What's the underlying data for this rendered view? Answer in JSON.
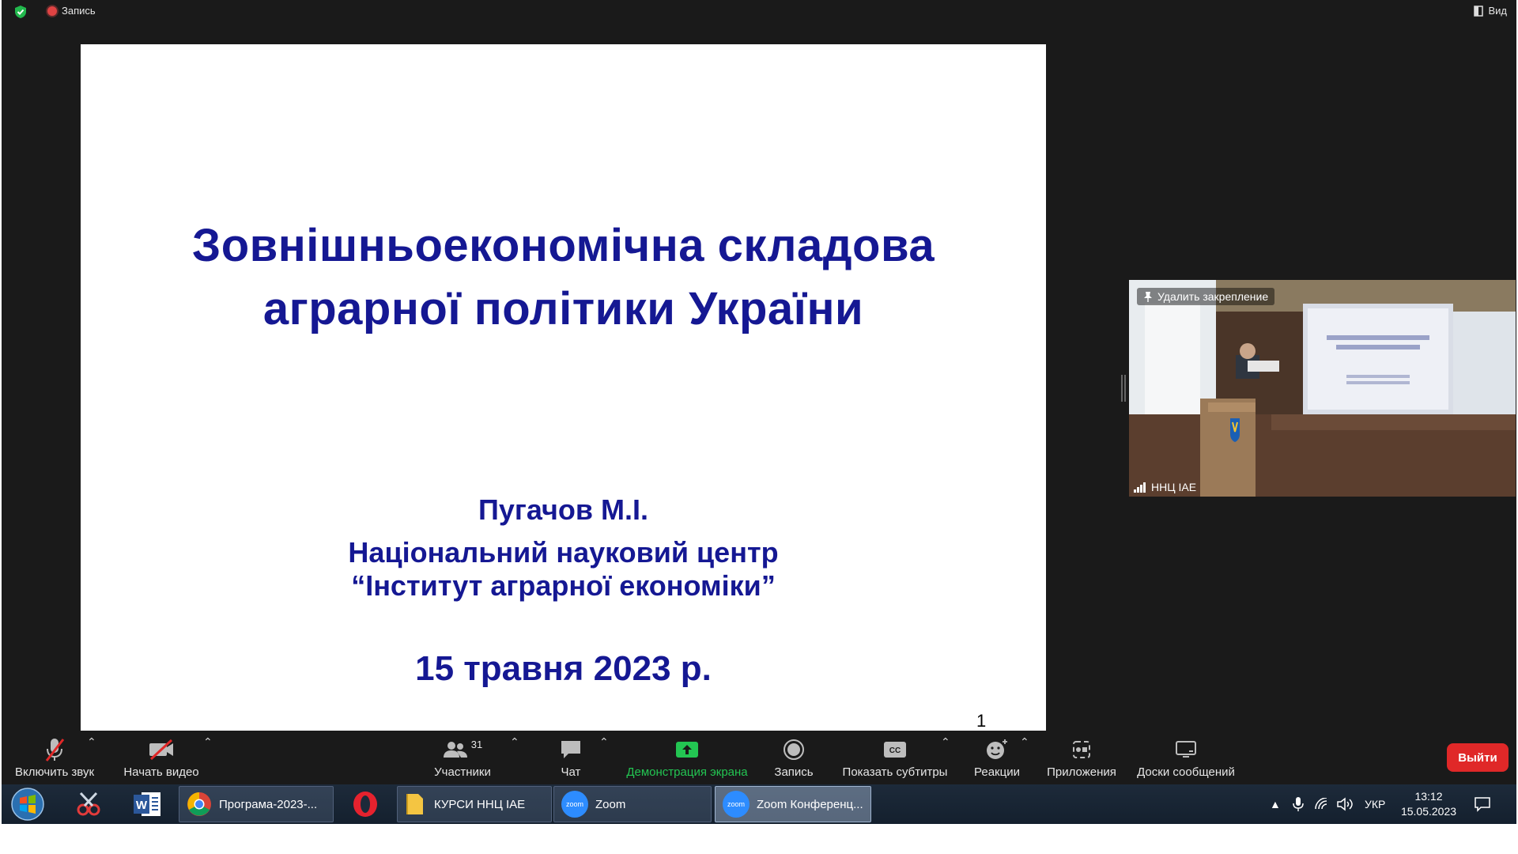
{
  "top_bar": {
    "recording_label": "Запись",
    "view_label": "Вид"
  },
  "slide": {
    "title_line1": "Зовнішньоекономічна складова",
    "title_line2": "аграрної політики України",
    "author": "Пугачов М.І.",
    "org_line1": "Національний науковий центр",
    "org_line2": "“Інститут аграрної економіки”",
    "date": "15 травня 2023 р.",
    "page_number": "1"
  },
  "video": {
    "unpin_label": "Удалить закрепление",
    "participant_name": "ННЦ ІАЕ"
  },
  "toolbar": {
    "unmute_label": "Включить звук",
    "start_video_label": "Начать видео",
    "participants_label": "Участники",
    "participants_count": "31",
    "chat_label": "Чат",
    "share_screen_label": "Демонстрация экрана",
    "record_label": "Запись",
    "captions_label": "Показать субтитры",
    "reactions_label": "Реакции",
    "apps_label": "Приложения",
    "whiteboards_label": "Доски сообщений",
    "leave_label": "Выйти"
  },
  "taskbar": {
    "tasks": [
      {
        "label": "Програма-2023-...",
        "icon": "chrome-icon"
      },
      {
        "label": "КУРСИ ННЦ ІАЕ",
        "icon": "folder-icon"
      },
      {
        "label": "Zoom",
        "icon": "zoom-icon"
      },
      {
        "label": "Zoom Конференц...",
        "icon": "zoom-icon"
      }
    ],
    "language": "УКР",
    "time": "13:12",
    "date": "15.05.2023"
  },
  "colors": {
    "slide_text": "#151893",
    "share_green": "#23c552",
    "leave_red": "#e02828",
    "zoom_bg": "#1a1a1a"
  }
}
